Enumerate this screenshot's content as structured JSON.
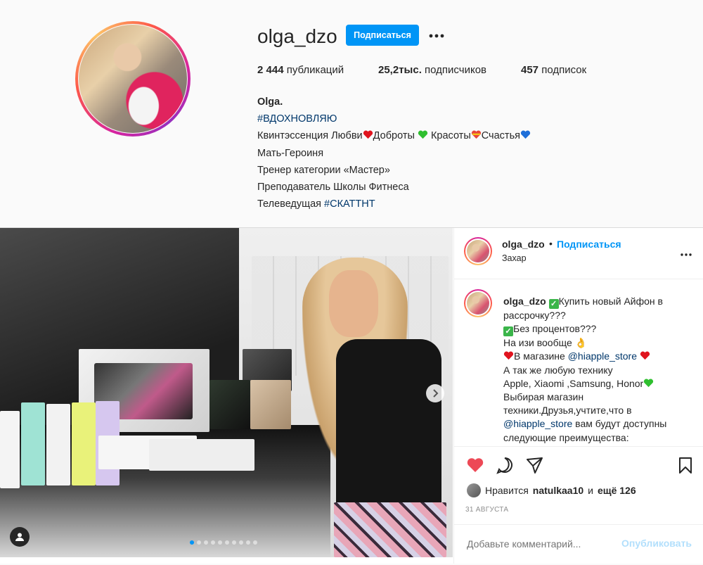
{
  "profile": {
    "username": "olga_dzo",
    "follow_label": "Подписаться",
    "more_label": "•••",
    "stats": {
      "posts_count": "2 444",
      "posts_label": "публикаций",
      "followers_count": "25,2тыс.",
      "followers_label": "подписчиков",
      "following_count": "457",
      "following_label": "подписок"
    },
    "bio": {
      "name": "Olga.",
      "hashtag": "#ВДОХНОВЛЯЮ",
      "line1_a": "Квинтэссенция Любви",
      "line1_b": "Доброты ",
      "line1_c": "Красоты",
      "line1_d": "Счастья",
      "line2": "Мать-Героиня",
      "line3": "Тренер категории «Мастер»",
      "line4": "Преподаватель Школы Фитнеса",
      "line5_text": "Телеведущая ",
      "line5_tag": "#СКАТТНТ"
    }
  },
  "post": {
    "header": {
      "username": "olga_dzo",
      "dot": "•",
      "follow_label": "Подписаться",
      "location": "Захар",
      "more_label": "•••"
    },
    "caption": {
      "username": "olga_dzo",
      "l1": "Купить новый Айфон в рассрочку???",
      "l2": "Без процентов???",
      "l3": "На изи вообще",
      "l4_a": "В магазине ",
      "l4_mention": "@hiapple_store",
      "l5": "А так же любую технику",
      "l6": "Apple, Xiaomi ,Samsung, Honor",
      "l7": "Выбирая магазин",
      "l8": "техники.Друзья,учтите,что в",
      "l9_mention": "@hiapple_store",
      "l9_b": " вам будут доступны",
      "l10": "следующие преимущества:"
    },
    "likes": {
      "prefix": "Нравится",
      "user": "natulkaa10",
      "middle": "и",
      "others": "ещё 126"
    },
    "date": "31 АВГУСТА",
    "comment_placeholder": "Добавьте комментарий...",
    "publish_label": "Опубликовать"
  },
  "colors": {
    "accent": "#0095f6",
    "heart": "#ed4956",
    "hashtag": "#00376b"
  },
  "icons": [
    "heart-filled-icon",
    "comment-icon",
    "share-icon",
    "bookmark-icon",
    "tagged-user-icon",
    "chevron-right-icon",
    "more-icon",
    "checkmark-emoji"
  ]
}
